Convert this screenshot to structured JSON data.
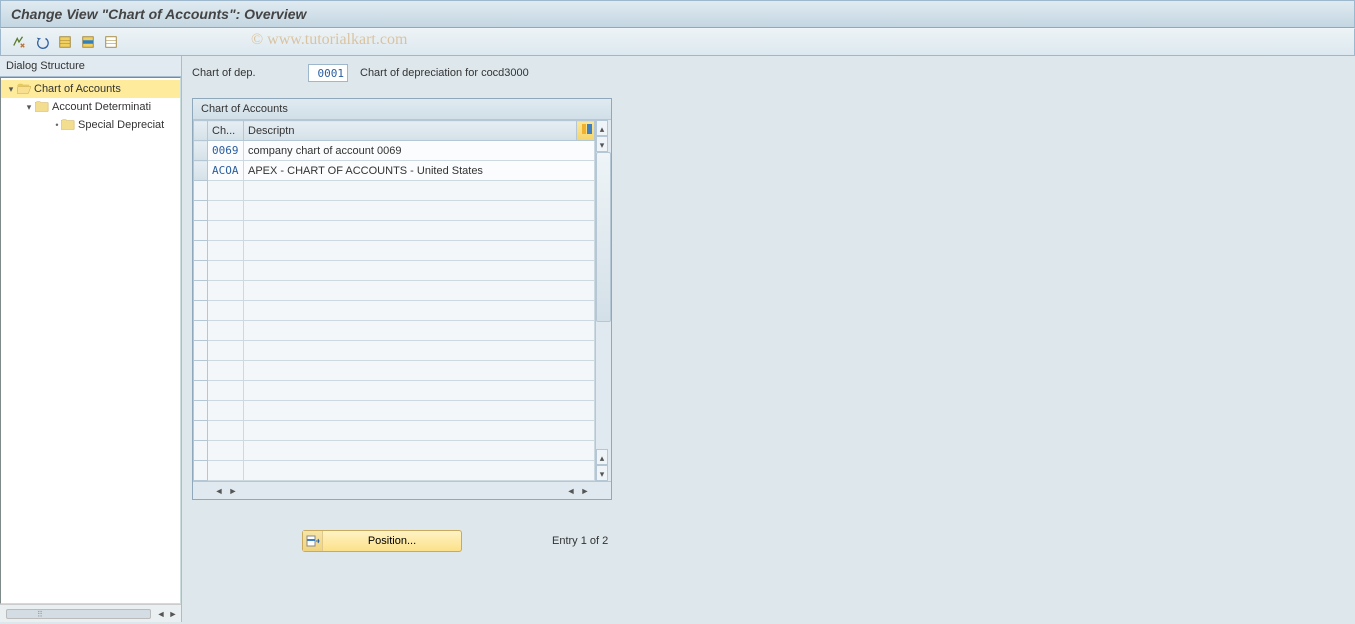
{
  "title": "Change View \"Chart of Accounts\": Overview",
  "watermark": "© www.tutorialkart.com",
  "toolbar": {
    "icons": [
      "toggle-display",
      "undo",
      "select-all",
      "select-block",
      "deselect-all"
    ]
  },
  "sidebar": {
    "title": "Dialog Structure",
    "nodes": [
      {
        "level": 1,
        "label": "Chart of Accounts",
        "open": true,
        "active": true
      },
      {
        "level": 2,
        "label": "Account Determinati",
        "open": true,
        "active": false
      },
      {
        "level": 3,
        "label": "Special Depreciat",
        "open": false,
        "active": false
      }
    ]
  },
  "header_field": {
    "label": "Chart of dep.",
    "value": "0001",
    "desc": "Chart of depreciation for cocd3000"
  },
  "grid": {
    "title": "Chart of Accounts",
    "columns": [
      "Ch...",
      "Descriptn"
    ],
    "rows": [
      {
        "code": "0069",
        "desc": "company chart of account 0069"
      },
      {
        "code": "ACOA",
        "desc": "APEX - CHART OF ACCOUNTS - United States"
      }
    ],
    "empty_row_count": 15
  },
  "footer": {
    "position_label": "Position...",
    "entry_text": "Entry 1 of 2"
  }
}
